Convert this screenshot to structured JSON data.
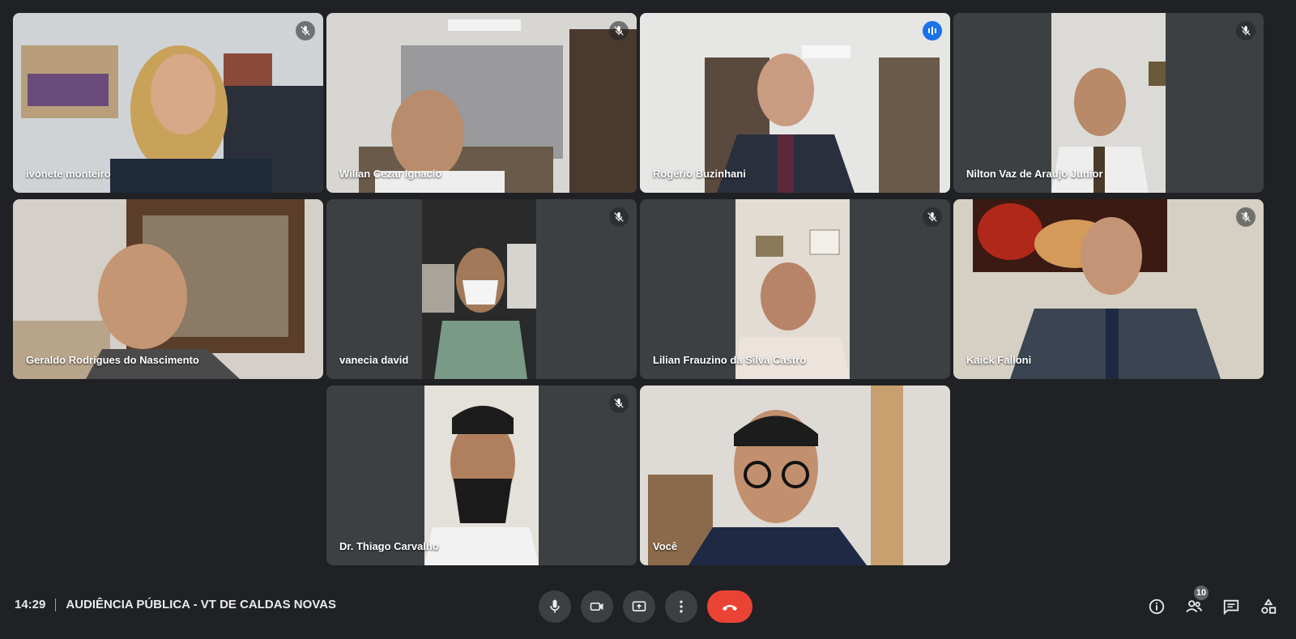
{
  "participants": [
    {
      "name": "ivonete monteiro",
      "muted": true
    },
    {
      "name": "Wilian Cezar Ignacio",
      "muted": true
    },
    {
      "name": "Rogério Buzinhani",
      "speaking": true
    },
    {
      "name": "Nilton Vaz de Araujo Junior",
      "muted": true
    },
    {
      "name": "Geraldo Rodrigues do Nascimento",
      "muted": false
    },
    {
      "name": "vanecia david",
      "muted": true
    },
    {
      "name": "Lilian Frauzino da Silva Castro",
      "muted": true
    },
    {
      "name": "Kaick Falloni",
      "muted": true
    },
    {
      "name": "Dr. Thiago Carvalho",
      "muted": true
    },
    {
      "name": "Você",
      "muted": false
    }
  ],
  "bottombar": {
    "time": "14:29",
    "meeting_title": "AUDIÊNCIA PÚBLICA - VT DE CALDAS NOVAS",
    "controls": [
      "microphone-icon",
      "camera-icon",
      "present-screen-icon",
      "more-options-icon",
      "hang-up-icon"
    ],
    "right_controls": [
      "meeting-details-icon",
      "people-icon",
      "chat-icon",
      "activities-icon"
    ],
    "people_count": "10"
  },
  "colors": {
    "background": "#202124",
    "tile": "#3c4043",
    "active_speaker_border": "#8ab4f8",
    "hangup": "#ea4335"
  }
}
